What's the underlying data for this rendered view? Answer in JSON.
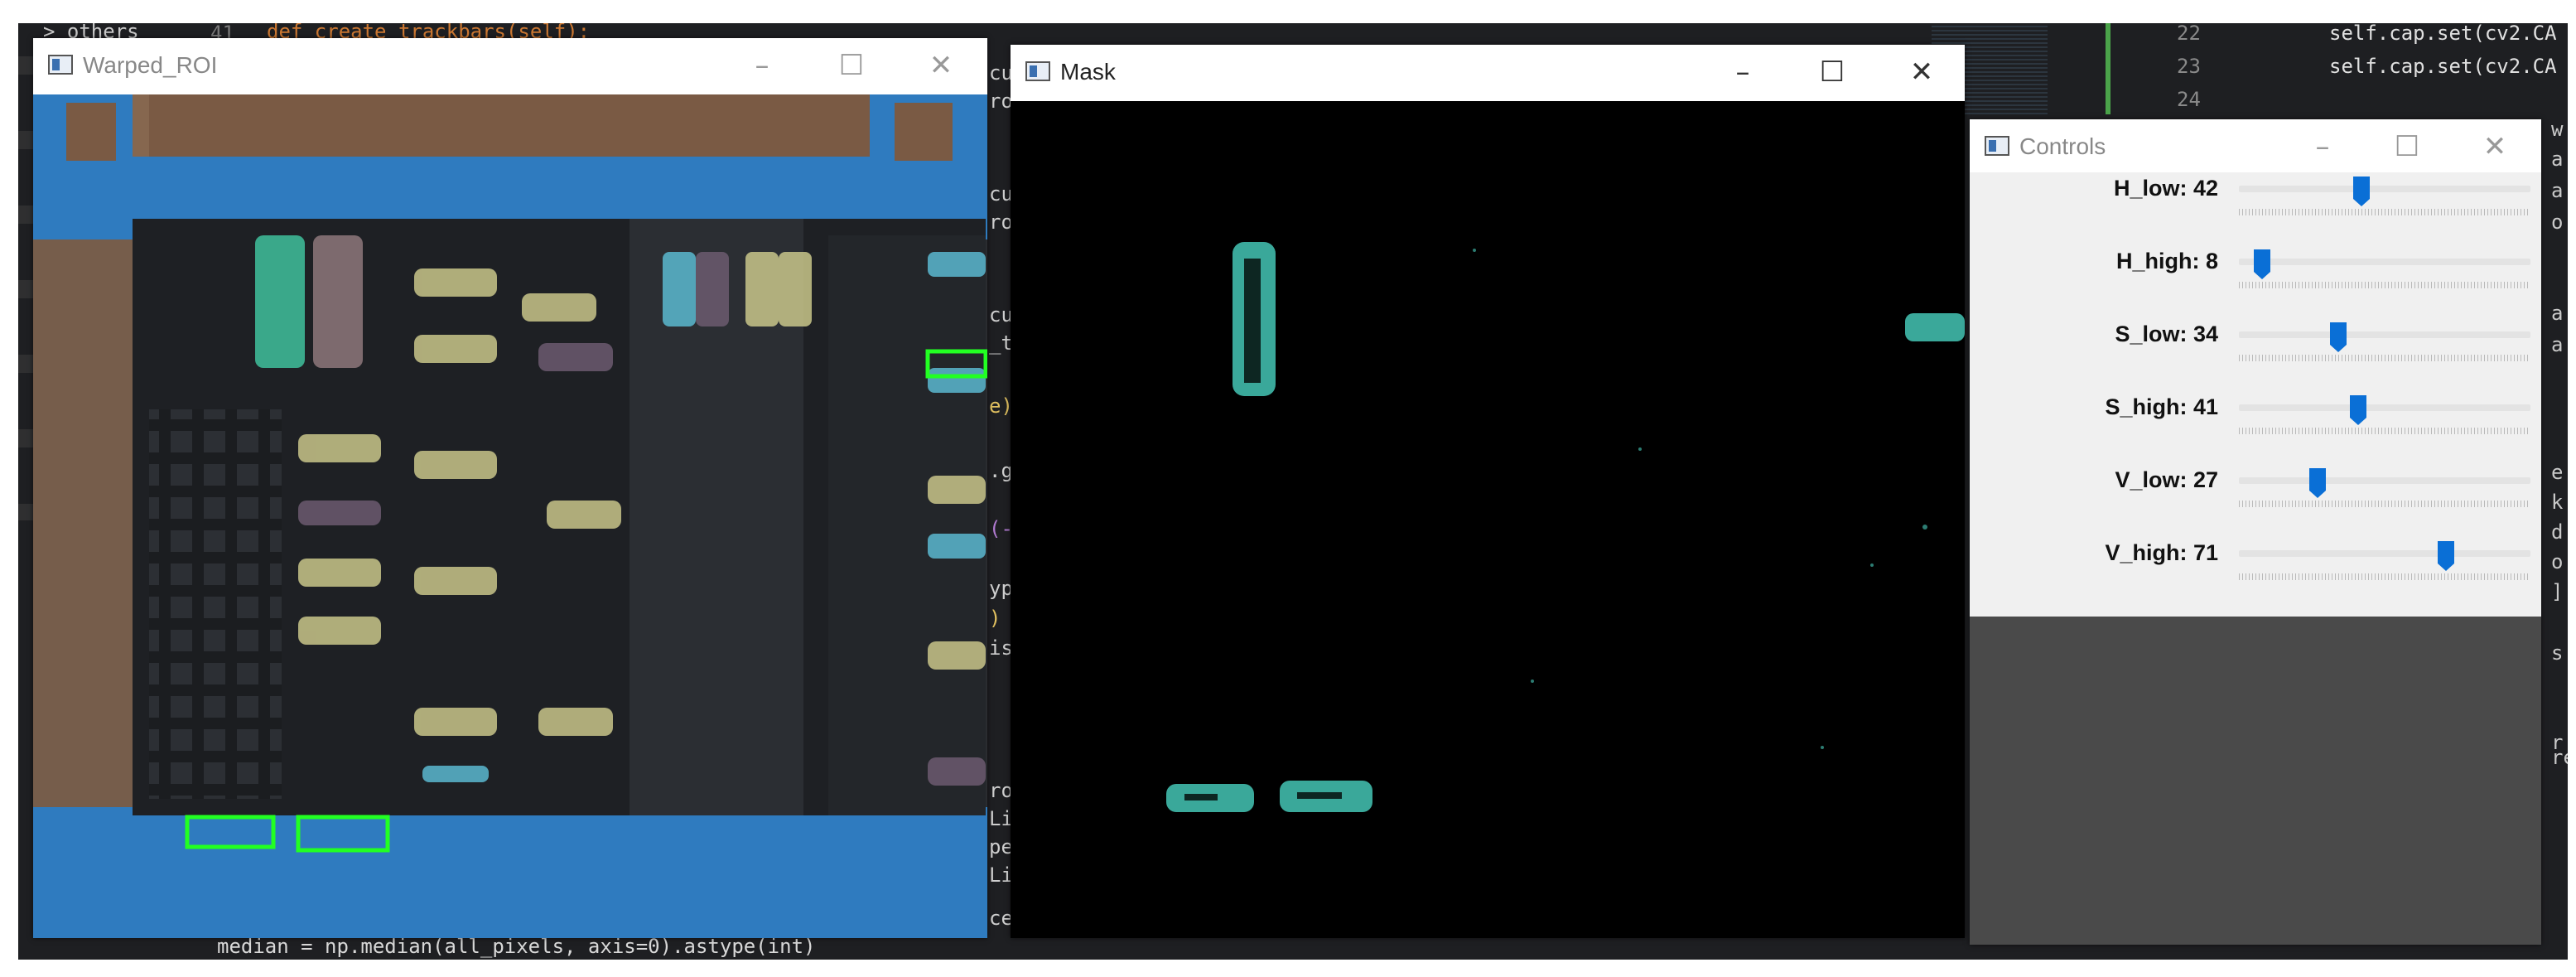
{
  "background_editor": {
    "tree_item": "> others",
    "line_number_top": "41",
    "def_line": "def create_trackbars(self):",
    "bottom_line": "median = np.median(all_pixels, axis=0).astype(int)",
    "right_line_numbers": [
      "22",
      "23",
      "24"
    ],
    "right_code": [
      "self.cap.set(cv2.CA",
      "self.cap.set(cv2.CA"
    ],
    "middle_fragments": [
      "cu",
      "ro",
      "cu",
      "ro",
      "cu",
      "_t",
      "e)",
      ".g",
      "(-",
      "yp",
      ")",
      "is",
      "ro",
      "Li",
      "pe",
      "Li",
      "ce"
    ],
    "right_fragments": [
      "w",
      "a",
      "a",
      "o",
      "a",
      "a",
      "e",
      "k",
      "d",
      "o",
      "]",
      "s",
      "r",
      "re"
    ]
  },
  "windows": {
    "warped": {
      "title": "Warped_ROI",
      "icon": "app-window-icon"
    },
    "mask": {
      "title": "Mask",
      "icon": "app-window-icon"
    },
    "controls": {
      "title": "Controls",
      "icon": "app-window-icon"
    }
  },
  "controls": {
    "max": 100,
    "trackbars": [
      {
        "label": "H_low: 42",
        "value": 42
      },
      {
        "label": "H_high: 8",
        "value": 8
      },
      {
        "label": "S_low: 34",
        "value": 34
      },
      {
        "label": "S_high: 41",
        "value": 41
      },
      {
        "label": "V_low: 27",
        "value": 27
      },
      {
        "label": "V_high: 71",
        "value": 71
      }
    ]
  },
  "colors": {
    "editor_bg": "#1e1f22",
    "highlight_box": "#22ff22",
    "mask_blob": "#3aa89a",
    "thumb": "#0a6fd6"
  }
}
